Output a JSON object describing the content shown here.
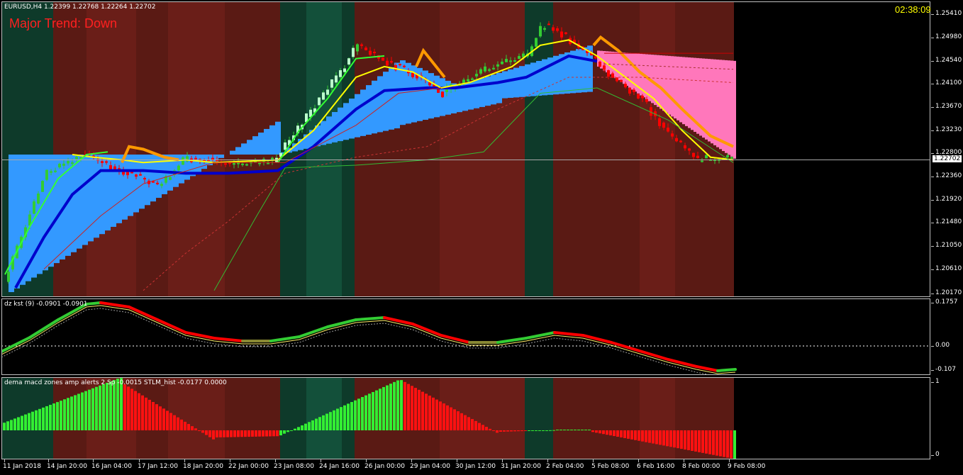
{
  "main_pane": {
    "header": "EURUSD,H4  1.22399 1.22768 1.22264 1.22702",
    "trend_text": "Major Trend: Down",
    "timer": "02:38:09",
    "current_price": "1.22702",
    "price_ticks": [
      "1.25410",
      "1.24980",
      "1.24540",
      "1.24100",
      "1.23670",
      "1.23230",
      "1.22800",
      "1.22360",
      "1.21920",
      "1.21480",
      "1.21050",
      "1.20610",
      "1.20170"
    ]
  },
  "kst_pane": {
    "header": "dz kst (9) -0.0901 -0.0901",
    "ticks": [
      "0.1757",
      "0.00",
      "-0.107"
    ]
  },
  "macd_pane": {
    "header": "dema macd zones amp alerts 2  Sp -0.0015  STLM_hist -0.0177 0.0000",
    "ticks": [
      "1",
      "0"
    ]
  },
  "x_axis": {
    "labels": [
      "11 Jan 2018",
      "14 Jan 20:00",
      "16 Jan 04:00",
      "17 Jan 12:00",
      "18 Jan 20:00",
      "22 Jan 00:00",
      "23 Jan 08:00",
      "24 Jan 16:00",
      "26 Jan 00:00",
      "29 Jan 04:00",
      "30 Jan 12:00",
      "31 Jan 20:00",
      "2 Feb 04:00",
      "5 Feb 08:00",
      "6 Feb 16:00",
      "8 Feb 00:00",
      "9 Feb 08:00"
    ]
  },
  "colors": {
    "bear_zone": "#5a1a14",
    "bear_zone_alt": "#6a1e18",
    "bull_zone": "#0e3a2a",
    "bull_zone_alt": "#13503a",
    "blue_cloud": "#3399ff",
    "pink_cloud": "#ff77bb",
    "up": "#33cc33",
    "down": "#ff0000",
    "orange": "#ff9900",
    "yellow": "#ffff00",
    "kst_up": "#33cc33",
    "kst_down": "#ff0000"
  }
}
